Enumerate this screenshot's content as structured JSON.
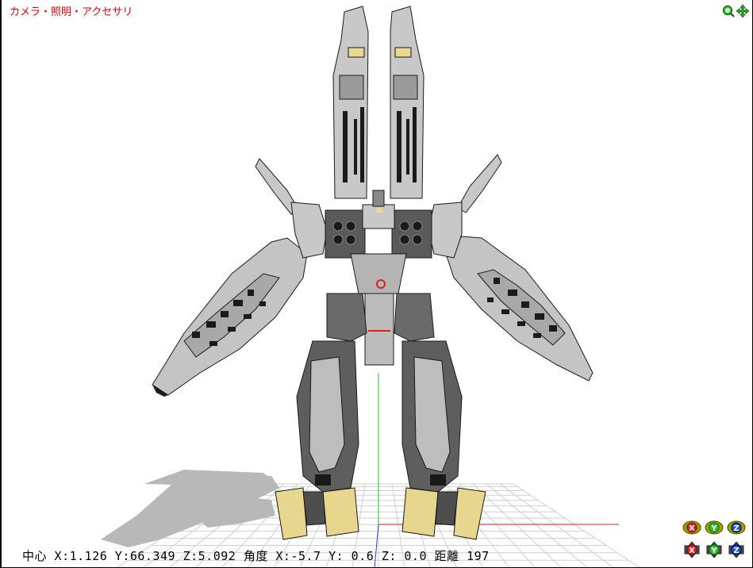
{
  "viewer": {
    "mode_label": "カメラ・照明・アクセサリ",
    "status": {
      "center_label": "中心",
      "center_x": "X:1.126",
      "center_y": "Y:66.349",
      "center_z": "Z:5.092",
      "angle_label": "角度",
      "angle_x": "X:-5.7",
      "angle_y": "Y: 0.6",
      "angle_z": "Z: 0.0",
      "distance_label": "距離",
      "distance_value": "197"
    },
    "icons": {
      "zoom": "zoom-icon",
      "move": "move-icon"
    },
    "axis_buttons": {
      "top_row": [
        "X",
        "Y",
        "Z"
      ],
      "bottom_row": [
        "X",
        "Y",
        "Z"
      ]
    }
  },
  "colors": {
    "mode_label": "#e00000",
    "grid": "#c8c8c8",
    "x_axis": "#e02020",
    "y_axis": "#20c020",
    "z_axis": "#2040e0",
    "mecha_light": "#c8c8c8",
    "mecha_dark": "#6a6a6a",
    "mecha_black": "#1a1a1a",
    "mecha_yellow": "#e8d890",
    "shadow": "#b4b4b4"
  }
}
